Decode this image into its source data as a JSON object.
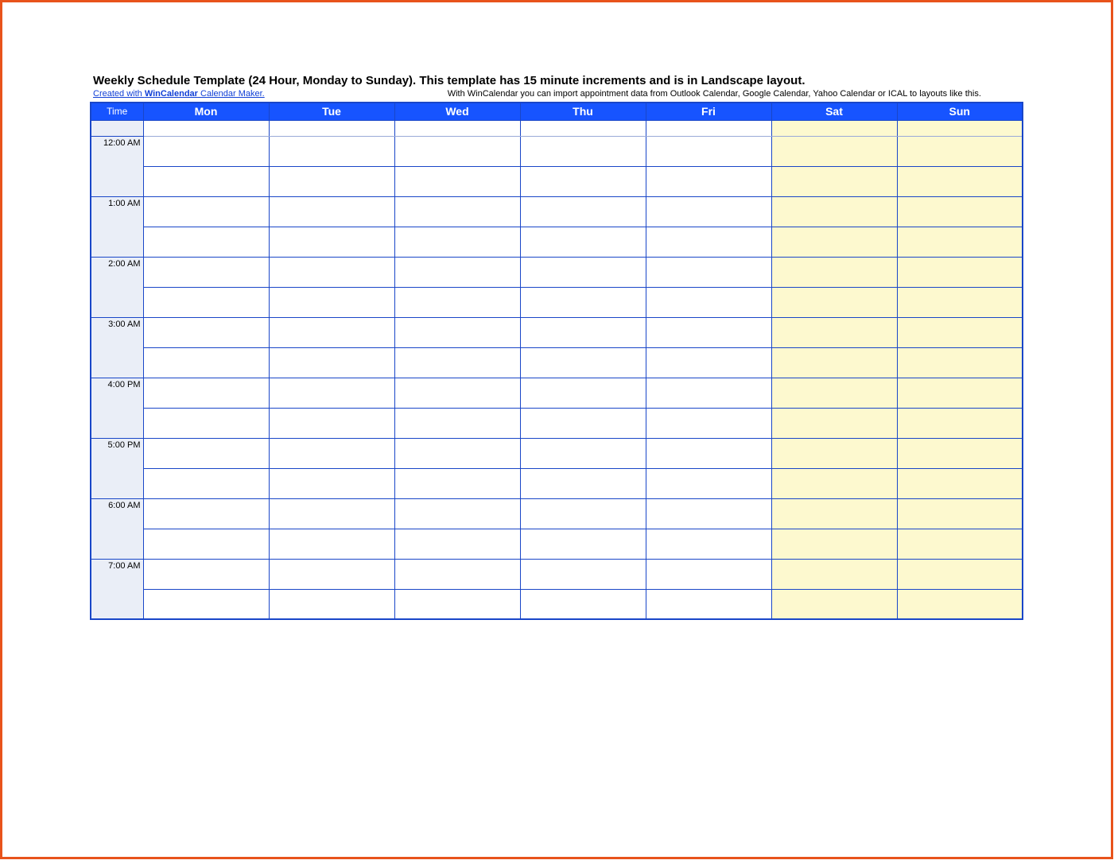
{
  "title": "Weekly Schedule Template (24 Hour, Monday to Sunday).  This template has 15 minute increments and is in Landscape layout.",
  "credit": {
    "prefix": "Created with ",
    "brand": "WinCalendar",
    "suffix": " Calendar Maker."
  },
  "note": "With WinCalendar you can import appointment data from Outlook Calendar, Google Calendar, Yahoo Calendar or ICAL to layouts like this.",
  "header": {
    "time": "Time",
    "days": [
      "Mon",
      "Tue",
      "Wed",
      "Thu",
      "Fri",
      "Sat",
      "Sun"
    ]
  },
  "weekend_index": [
    5,
    6
  ],
  "hours": [
    "12:00 AM",
    "1:00 AM",
    "2:00 AM",
    "3:00 AM",
    "4:00 PM",
    "5:00 PM",
    "6:00 AM",
    "7:00 AM"
  ]
}
